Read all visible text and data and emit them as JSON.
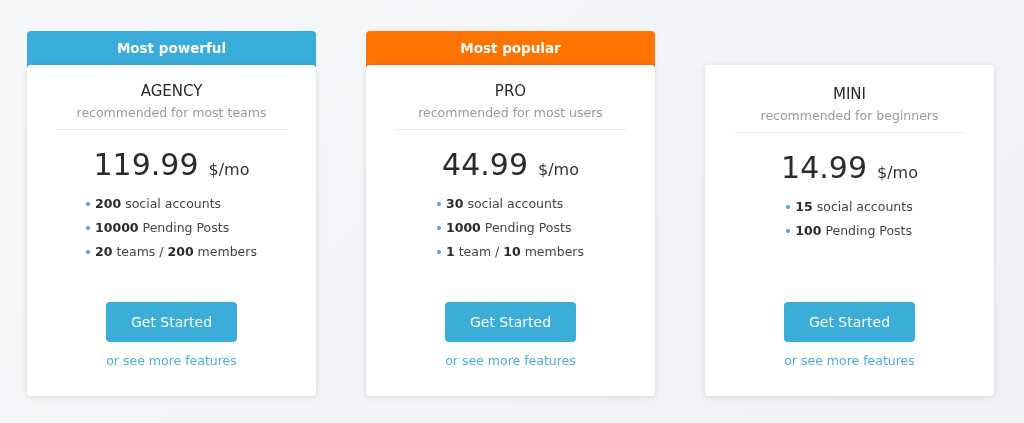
{
  "plans": [
    {
      "ribbon": {
        "label": "Most powerful",
        "color": "#3aacd9"
      },
      "name": "AGENCY",
      "subtitle": "recommended for most teams",
      "price": "119.99",
      "unit": "$/mo",
      "features": [
        "**200** social accounts",
        "**10000** Pending Posts",
        "**20** teams / **200** members"
      ],
      "button": "Get Started",
      "link": "or see more features"
    },
    {
      "ribbon": {
        "label": "Most popular",
        "color": "#ff7300"
      },
      "name": "PRO",
      "subtitle": "recommended for most users",
      "price": "44.99",
      "unit": "$/mo",
      "features": [
        "**30** social accounts",
        "**1000** Pending Posts",
        "**1** team / **10** members"
      ],
      "button": "Get Started",
      "link": "or see more features"
    },
    {
      "name": "MINI",
      "subtitle": "recommended for beginners",
      "price": "14.99",
      "unit": "$/mo",
      "features": [
        "**15** social accounts",
        "**100** Pending Posts"
      ],
      "button": "Get Started",
      "link": "or see more features"
    }
  ]
}
